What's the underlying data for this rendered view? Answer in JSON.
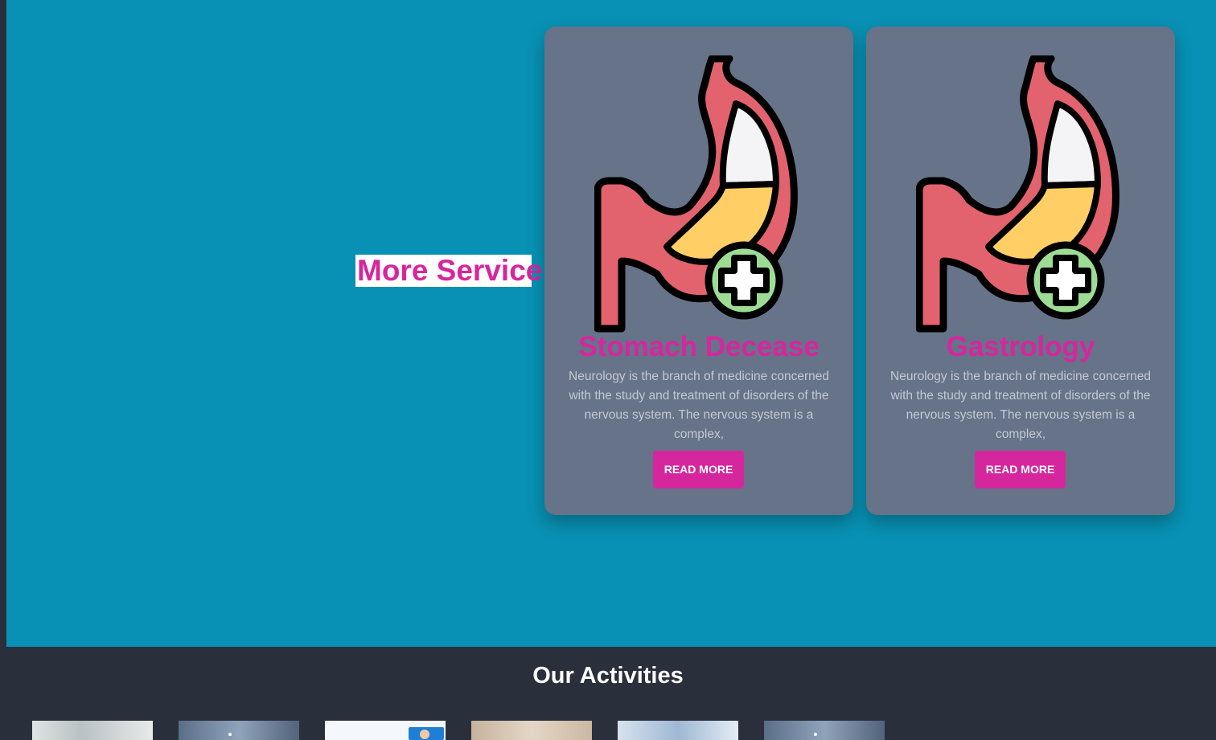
{
  "services": {
    "heading": "More Service",
    "bg_color": "#0891b4",
    "accent_color": "#d6269e",
    "cards": [
      {
        "title": "Stomach Decease",
        "description": "Neurology is the branch of medicine concerned with the study and treatment of disorders of the nervous system. The nervous system is a complex,",
        "button_label": "READ MORE",
        "icon": "stomach-medical-icon"
      },
      {
        "title": "Gastrology",
        "description": "Neurology is the branch of medicine concerned with the study and treatment of disorders of the nervous system. The nervous system is a complex,",
        "button_label": "READ MORE",
        "icon": "stomach-medical-icon"
      }
    ]
  },
  "activities": {
    "heading": "Our Activities",
    "thumbnails": [
      "activity-photo-1",
      "activity-photo-2",
      "activity-photo-3",
      "activity-photo-4",
      "activity-photo-5",
      "activity-photo-6"
    ]
  }
}
